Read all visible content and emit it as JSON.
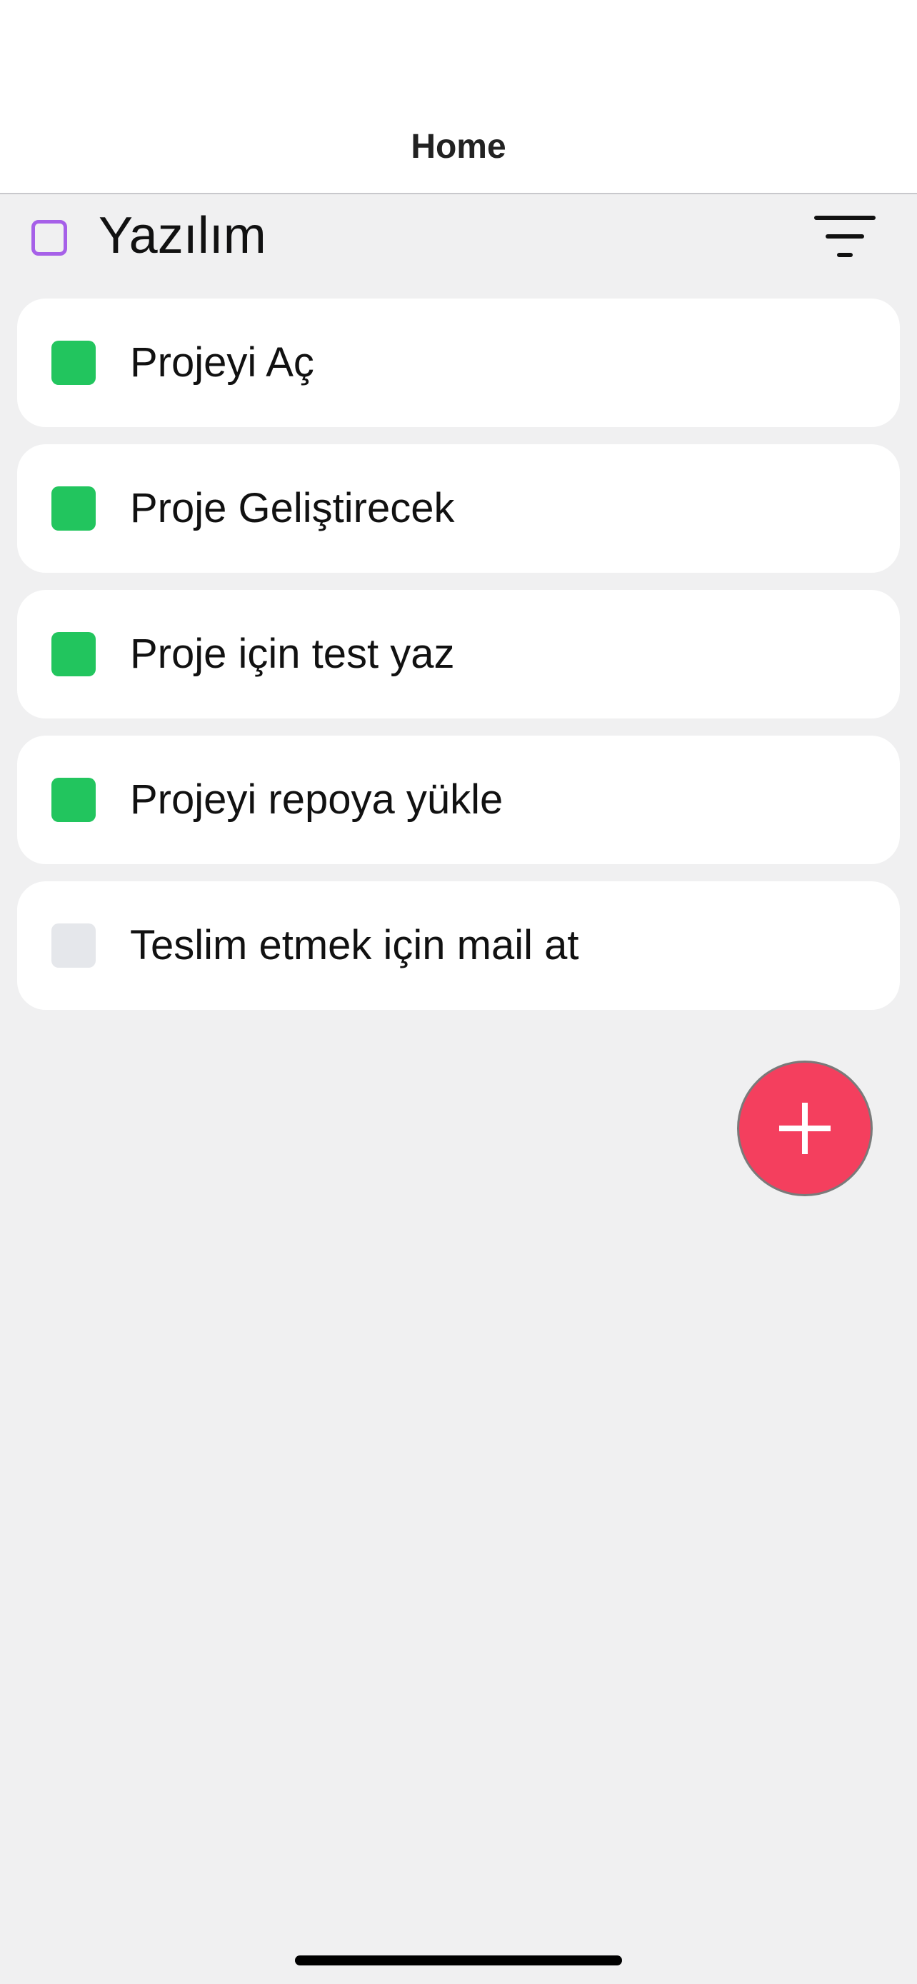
{
  "header": {
    "title": "Home"
  },
  "category": {
    "name": "Yazılım",
    "icon": "square-outline-icon",
    "icon_color": "#a660e8",
    "filter_icon": "filter-lines-icon"
  },
  "tasks": [
    {
      "label": "Projeyi Aç",
      "done": true
    },
    {
      "label": "Proje Geliştirecek",
      "done": true
    },
    {
      "label": "Proje için test yaz",
      "done": true
    },
    {
      "label": "Projeyi repoya yükle",
      "done": true
    },
    {
      "label": "Teslim etmek için mail at",
      "done": false
    }
  ],
  "colors": {
    "done": "#22c55e",
    "pending": "#e5e7eb",
    "fab": "#f43f5e",
    "background": "#f0f0f1"
  },
  "fab": {
    "icon": "plus-icon"
  }
}
